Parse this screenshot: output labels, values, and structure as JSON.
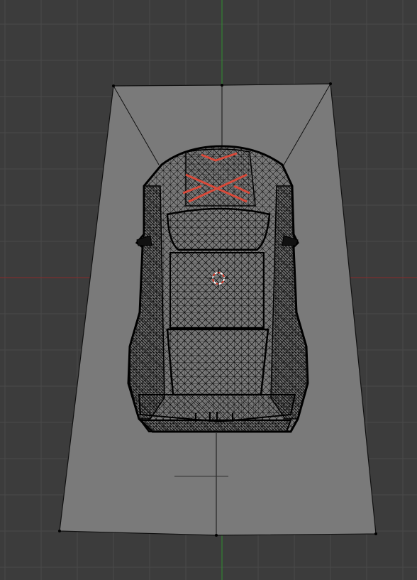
{
  "viewport": {
    "view": "top-orthographic",
    "mode": "edit-mode-wireframe",
    "background_color": "#3c3c3c",
    "grid_color": "#4a4a4a",
    "x_axis_color": "#8b2a2a",
    "y_axis_color": "#2f8f2f"
  },
  "mesh": {
    "plane_fill": "#7a7a7a",
    "plane_edge_color": "#111111",
    "car_wire_color": "#0a0a0a",
    "selected_edge_color": "#d84a3a"
  },
  "cursor": {
    "icon": "3d-cursor-icon",
    "ring_colors": [
      "#d93a2a",
      "#ffffff"
    ]
  }
}
